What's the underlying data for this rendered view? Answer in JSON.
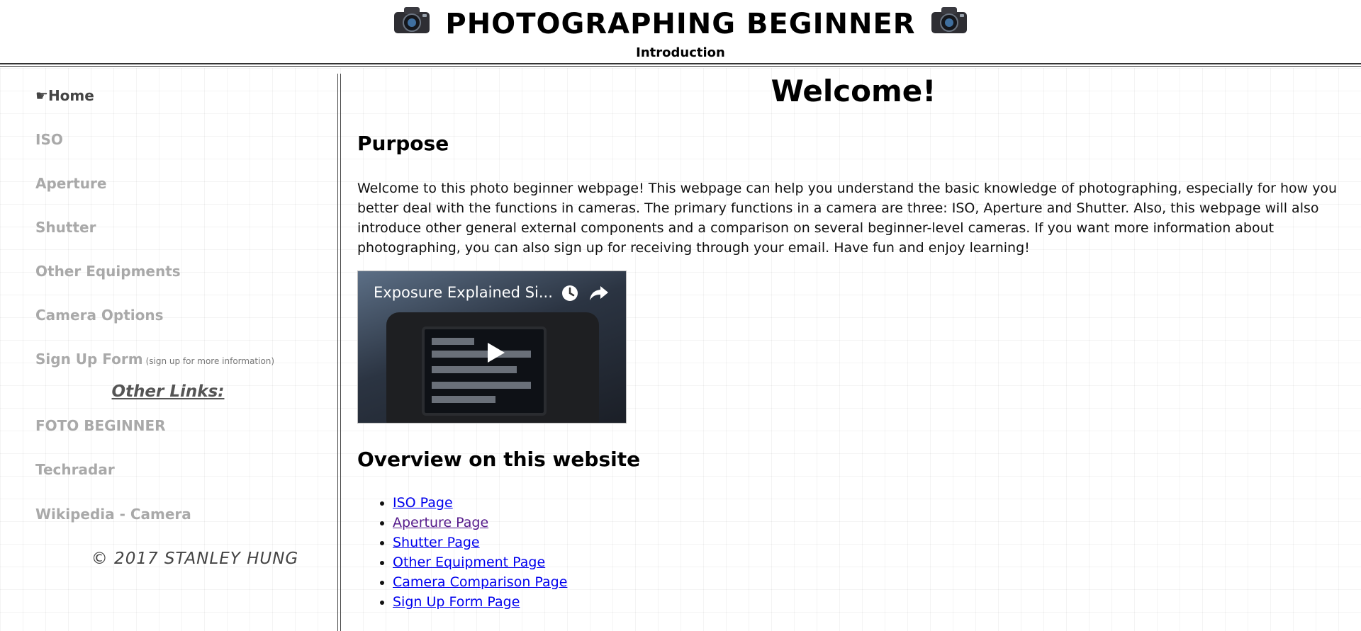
{
  "header": {
    "title": "PHOTOGRAPHING BEGINNER",
    "subtitle": "Introduction",
    "icon": "camera-icon"
  },
  "sidebar": {
    "items": [
      {
        "label": "Home",
        "prefix": "☛",
        "active": true
      },
      {
        "label": "ISO"
      },
      {
        "label": "Aperture"
      },
      {
        "label": "Shutter"
      },
      {
        "label": "Other Equipments"
      },
      {
        "label": "Camera Options"
      },
      {
        "label": "Sign Up Form",
        "note": "(sign up for more information)"
      }
    ],
    "other_links_heading": "Other Links:",
    "other_links": [
      {
        "label": "FOTO BEGINNER"
      },
      {
        "label": "Techradar"
      },
      {
        "label": "Wikipedia - Camera"
      }
    ],
    "copyright": "© 2017 STANLEY HUNG"
  },
  "main": {
    "heading": "Welcome!",
    "purpose": {
      "heading": "Purpose",
      "text": "Welcome to this photo beginner webpage! This webpage can help you understand the basic knowledge of photographing, especially for how you better deal with the functions in cameras. The primary functions in a camera are three: ISO, Aperture and Shutter. Also, this webpage will also introduce other general external components and a comparison on several beginner-level cameras. If you want more information about photographing, you can also sign up for receiving through your email. Have fun and enjoy learning!"
    },
    "video": {
      "title": "Exposure Explained Si...",
      "play_icon": "play-icon",
      "clock_icon": "clock-icon",
      "share_icon": "share-icon"
    },
    "overview": {
      "heading": "Overview on this website",
      "links": [
        {
          "label": "ISO Page",
          "visited": false
        },
        {
          "label": "Aperture Page",
          "visited": true
        },
        {
          "label": "Shutter Page",
          "visited": false
        },
        {
          "label": "Other Equipment Page",
          "visited": false
        },
        {
          "label": "Camera Comparison Page",
          "visited": false
        },
        {
          "label": "Sign Up Form Page",
          "visited": false
        }
      ]
    }
  },
  "colors": {
    "nav_text": "#a9a9a9",
    "nav_active": "#444444",
    "link": "#0000ee",
    "link_visited": "#551a8b"
  }
}
